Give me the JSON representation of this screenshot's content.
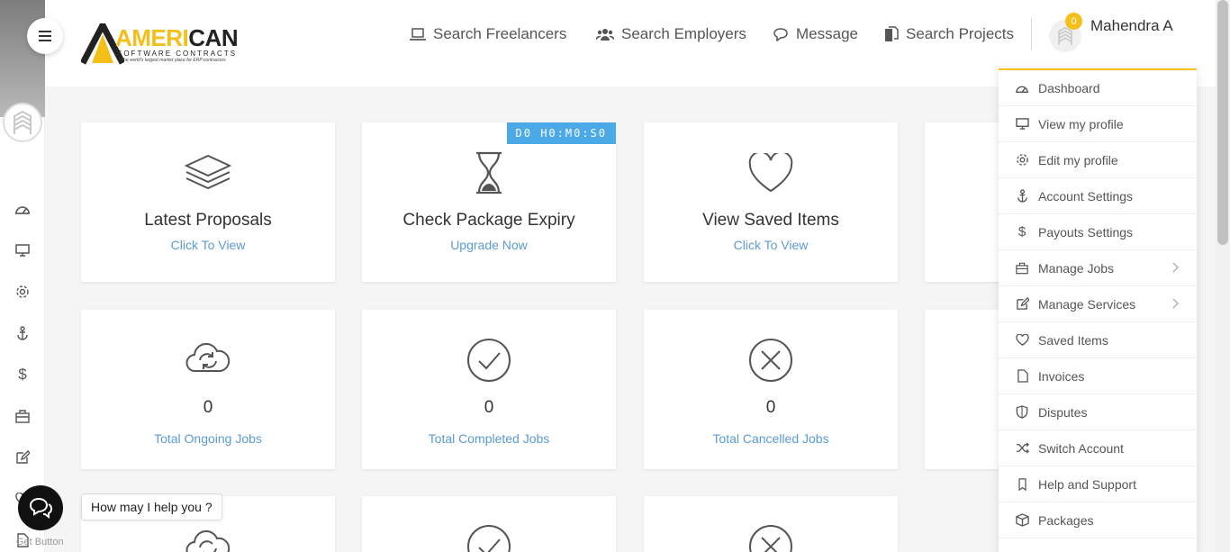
{
  "brand": {
    "name_part1": "AMERI",
    "name_part2": "CAN",
    "subtitle": "SOFTWARE CONTRACTS",
    "tagline": "The world's largest market place for ERP contractors"
  },
  "nav": [
    {
      "label": "Search Freelancers",
      "icon": "laptop-icon"
    },
    {
      "label": "Search Employers",
      "icon": "users-icon"
    },
    {
      "label": "Message",
      "icon": "chat-icon"
    },
    {
      "label": "Search Projects",
      "icon": "documents-icon"
    }
  ],
  "user": {
    "name": "Mahendra A",
    "notifications": "0"
  },
  "cards": [
    {
      "title": "Latest Proposals",
      "link": "Click To View",
      "icon": "layers-icon"
    },
    {
      "title": "Check Package Expiry",
      "link": "Upgrade Now",
      "icon": "hourglass-icon",
      "timer": "D0 H0:M0:S0"
    },
    {
      "title": "View Saved Items",
      "link": "Click To View",
      "icon": "heart-icon"
    }
  ],
  "stats": [
    {
      "value": "0",
      "label": "Total Ongoing Jobs",
      "icon": "cloud-sync-icon"
    },
    {
      "value": "0",
      "label": "Total Completed Jobs",
      "icon": "check-circle-icon"
    },
    {
      "value": "0",
      "label": "Total Cancelled Jobs",
      "icon": "x-circle-icon"
    }
  ],
  "menu": [
    {
      "label": "Dashboard",
      "icon": "gauge-icon",
      "submenu": false
    },
    {
      "label": "View my profile",
      "icon": "monitor-icon",
      "submenu": false
    },
    {
      "label": "Edit my profile",
      "icon": "gear-icon",
      "submenu": false
    },
    {
      "label": "Account Settings",
      "icon": "anchor-icon",
      "submenu": false
    },
    {
      "label": "Payouts Settings",
      "icon": "dollar-icon",
      "submenu": false
    },
    {
      "label": "Manage Jobs",
      "icon": "briefcase-icon",
      "submenu": true
    },
    {
      "label": "Manage Services",
      "icon": "edit-icon",
      "submenu": true
    },
    {
      "label": "Saved Items",
      "icon": "heart-icon",
      "submenu": false
    },
    {
      "label": "Invoices",
      "icon": "file-icon",
      "submenu": false
    },
    {
      "label": "Disputes",
      "icon": "shield-icon",
      "submenu": false
    },
    {
      "label": "Switch Account",
      "icon": "shuffle-icon",
      "submenu": false
    },
    {
      "label": "Help and Support",
      "icon": "bookmark-icon",
      "submenu": false
    },
    {
      "label": "Packages",
      "icon": "box-icon",
      "submenu": false
    }
  ],
  "chat": {
    "prompt": "How may I help you ?",
    "label": "Get Button"
  },
  "colors": {
    "accent": "#f5bf1a",
    "link": "#5b9bd5",
    "timer": "#4ba9e8"
  }
}
